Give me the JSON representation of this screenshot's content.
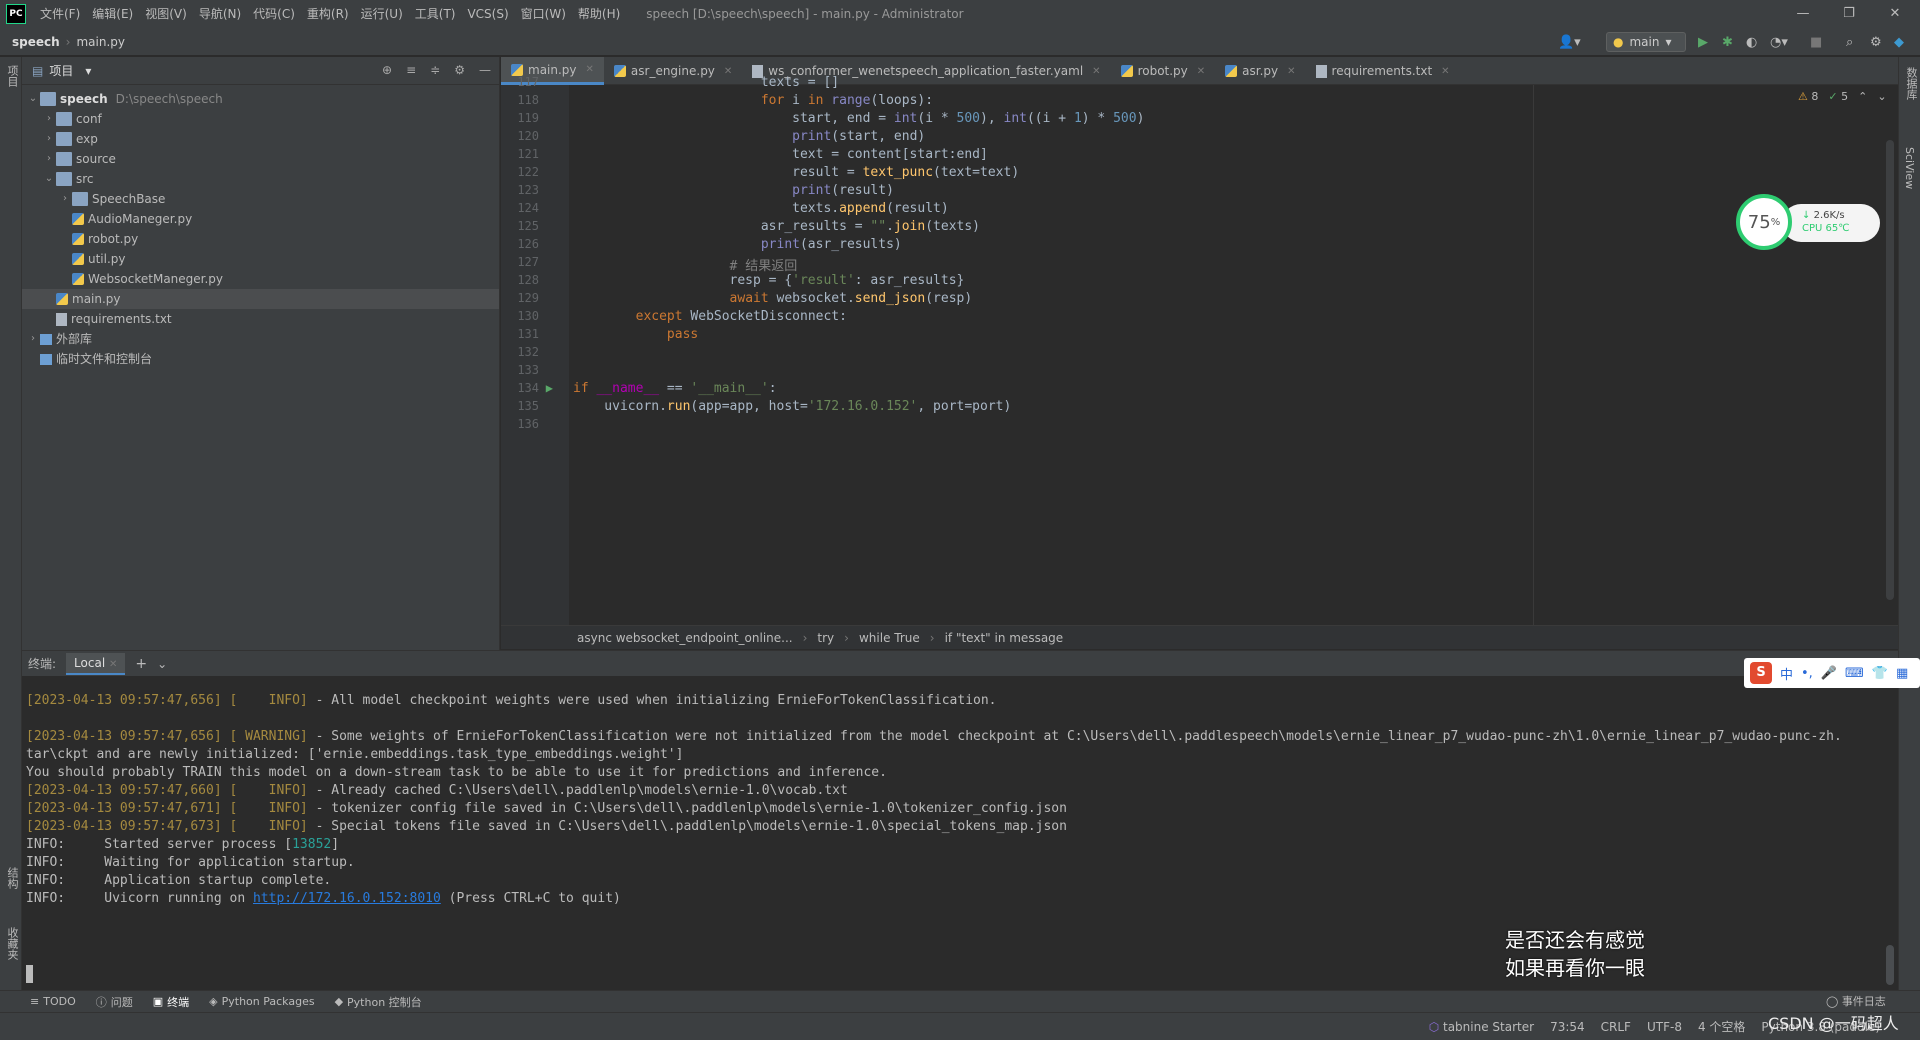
{
  "titlebar": {
    "logo": "PC",
    "menu": [
      "文件(F)",
      "编辑(E)",
      "视图(V)",
      "导航(N)",
      "代码(C)",
      "重构(R)",
      "运行(U)",
      "工具(T)",
      "VCS(S)",
      "窗口(W)",
      "帮助(H)"
    ],
    "title": "speech [D:\\speech\\speech] - main.py - Administrator"
  },
  "navbar": {
    "project": "speech",
    "file": "main.py",
    "run_config": "main"
  },
  "project_panel": {
    "title": "项目",
    "tree": [
      {
        "label": "speech",
        "path": "D:\\speech\\speech",
        "type": "folder",
        "depth": 0,
        "expanded": true
      },
      {
        "label": "conf",
        "type": "folder",
        "depth": 1
      },
      {
        "label": "exp",
        "type": "folder",
        "depth": 1
      },
      {
        "label": "source",
        "type": "folder",
        "depth": 1
      },
      {
        "label": "src",
        "type": "folder",
        "depth": 1,
        "expanded": true
      },
      {
        "label": "SpeechBase",
        "type": "folder",
        "depth": 2
      },
      {
        "label": "AudioManeger.py",
        "type": "py",
        "depth": 2
      },
      {
        "label": "robot.py",
        "type": "py",
        "depth": 2
      },
      {
        "label": "util.py",
        "type": "py",
        "depth": 2
      },
      {
        "label": "WebsocketManeger.py",
        "type": "py",
        "depth": 2
      },
      {
        "label": "main.py",
        "type": "py",
        "depth": 1,
        "selected": true
      },
      {
        "label": "requirements.txt",
        "type": "txt",
        "depth": 1
      },
      {
        "label": "外部库",
        "type": "lib",
        "depth": 0
      },
      {
        "label": "临时文件和控制台",
        "type": "scratch",
        "depth": 0
      }
    ]
  },
  "left_strip": {
    "top_label": "项目",
    "bottom_label1": "结构",
    "bottom_label2": "收藏夹"
  },
  "right_strip": {
    "label1": "数据库",
    "label2": "SciView"
  },
  "tabs": [
    {
      "label": "main.py",
      "active": true
    },
    {
      "label": "asr_engine.py"
    },
    {
      "label": "ws_conformer_wenetspeech_application_faster.yaml"
    },
    {
      "label": "robot.py"
    },
    {
      "label": "asr.py"
    },
    {
      "label": "requirements.txt"
    }
  ],
  "inspections": {
    "warnings": "8",
    "ok": "5"
  },
  "code": {
    "lines": [
      {
        "n": "117",
        "html": "                        texts = []"
      },
      {
        "n": "118",
        "html": "                        <span class='kw'>for</span> i <span class='kw'>in</span> <span class='bi'>range</span>(loops):"
      },
      {
        "n": "119",
        "html": "                            start, end = <span class='bi'>int</span>(i * <span class='nm'>500</span>), <span class='bi'>int</span>((i + <span class='nm'>1</span>) * <span class='nm'>500</span>)"
      },
      {
        "n": "120",
        "html": "                            <span class='bi'>print</span>(start, end)"
      },
      {
        "n": "121",
        "html": "                            text = content[start:end]"
      },
      {
        "n": "122",
        "html": "                            result = <span class='fn'>text_punc</span>(text=text)"
      },
      {
        "n": "123",
        "html": "                            <span class='bi'>print</span>(result)"
      },
      {
        "n": "124",
        "html": "                            texts.<span class='fn'>append</span>(result)"
      },
      {
        "n": "125",
        "html": "                        asr_results = <span class='st'>\"\"</span>.<span class='fn'>join</span>(texts)"
      },
      {
        "n": "126",
        "html": "                        <span class='bi'>print</span>(asr_results)"
      },
      {
        "n": "127",
        "html": "                    <span class='cm'># 结果返回</span>"
      },
      {
        "n": "128",
        "html": "                    resp = {<span class='st'>'result'</span>: asr_results}"
      },
      {
        "n": "129",
        "html": "                    <span class='kw'>await</span> websocket.<span class='fn'>send_json</span>(resp)"
      },
      {
        "n": "130",
        "html": "        <span class='kw'>except</span> WebSocketDisconnect:"
      },
      {
        "n": "131",
        "html": "            <span class='kw'>pass</span>"
      },
      {
        "n": "132",
        "html": ""
      },
      {
        "n": "133",
        "html": ""
      },
      {
        "n": "134",
        "html": "<span class='kw'>if</span> <span class='mc'>__name__</span> == <span class='st'>'__main__'</span>:"
      },
      {
        "n": "135",
        "html": "    uvicorn.<span class='fn'>run</span>(app=app, host=<span class='st'>'172.16.0.152'</span>, port=port)"
      },
      {
        "n": "136",
        "html": ""
      }
    ]
  },
  "breadcrumb": [
    "async websocket_endpoint_online...",
    "try",
    "while True",
    "if \"text\" in message"
  ],
  "terminal": {
    "label": "终端:",
    "tab": "Local",
    "lines": [
      {
        "html": "<span class='dt'>[2023-04-13 09:57:47,656] [    INFO]</span> - All model checkpoint weights were used when initializing ErnieForTokenClassification."
      },
      {
        "html": ""
      },
      {
        "html": "<span class='dt'>[2023-04-13 09:57:47,656] [ WARNING]</span> - Some weights of ErnieForTokenClassification were not initialized from the model checkpoint at C:\\Users\\dell\\.paddlespeech\\models\\ernie_linear_p7_wudao-punc-zh\\1.0\\ernie_linear_p7_wudao-punc-zh."
      },
      {
        "html": "tar\\ckpt and are newly initialized: ['ernie.embeddings.task_type_embeddings.weight']"
      },
      {
        "html": "You should probably TRAIN this model on a down-stream task to be able to use it for predictions and inference."
      },
      {
        "html": "<span class='dt'>[2023-04-13 09:57:47,660] [    INFO]</span> - Already cached C:\\Users\\dell\\.paddlenlp\\models\\ernie-1.0\\vocab.txt"
      },
      {
        "html": "<span class='dt'>[2023-04-13 09:57:47,671] [    INFO]</span> - tokenizer config file saved in C:\\Users\\dell\\.paddlenlp\\models\\ernie-1.0\\tokenizer_config.json"
      },
      {
        "html": "<span class='dt'>[2023-04-13 09:57:47,673] [    INFO]</span> - Special tokens file saved in C:\\Users\\dell\\.paddlenlp\\models\\ernie-1.0\\special_tokens_map.json"
      },
      {
        "html": "INFO:     Started server process [<span class='pid'>13852</span>]"
      },
      {
        "html": "INFO:     Waiting for application startup."
      },
      {
        "html": "INFO:     Application startup complete."
      },
      {
        "html": "INFO:     Uvicorn running on <span class='url'>http://172.16.0.152:8010</span> (Press CTRL+C to quit)"
      }
    ]
  },
  "bottom_tabs": [
    "TODO",
    "问题",
    "终端",
    "Python Packages",
    "Python 控制台"
  ],
  "event_log": "事件日志",
  "status": {
    "tabnine": "tabnine Starter",
    "pos": "73:54",
    "eol": "CRLF",
    "enc": "UTF-8",
    "indent": "4 个空格",
    "interp": "Python 3.8 (paddle)"
  },
  "widget": {
    "percent": "75",
    "unit": "%",
    "speed": "2.6K/s",
    "cpu": "CPU 65℃"
  },
  "ime": {
    "logo": "S",
    "items": [
      "中",
      "•,",
      "🎤",
      "⌨",
      "👕",
      "▦"
    ]
  },
  "overlay": {
    "line1": "是否还会有感觉",
    "line2": "如果再看你一眼"
  },
  "watermark": "CSDN @一码超人"
}
